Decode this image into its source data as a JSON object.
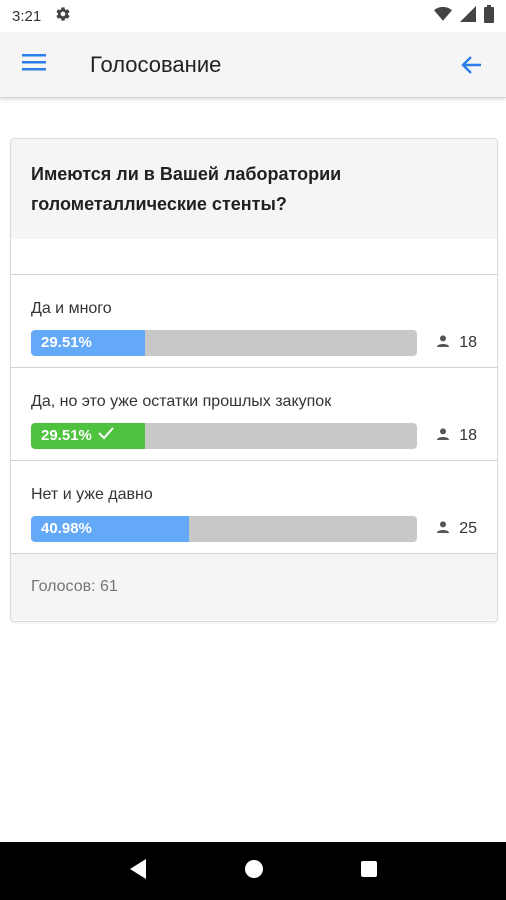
{
  "status_bar": {
    "time": "3:21"
  },
  "header": {
    "title": "Голосование"
  },
  "poll": {
    "question": "Имеются ли в Вашей лаборатории голометаллические стенты?",
    "options": [
      {
        "label": "Да и много",
        "percent_label": "29.51%",
        "fraction": 0.2951,
        "count": "18",
        "selected": false,
        "color": "#64a9f7"
      },
      {
        "label": "Да, но это уже остатки прошлых закупок",
        "percent_label": "29.51%",
        "fraction": 0.2951,
        "count": "18",
        "selected": true,
        "color": "#4fc23f"
      },
      {
        "label": "Нет и уже давно",
        "percent_label": "40.98%",
        "fraction": 0.4098,
        "count": "25",
        "selected": false,
        "color": "#64a9f7"
      }
    ],
    "total_votes": "Голосов: 61"
  },
  "colors": {
    "accent": "#2b7de9",
    "bar_bg": "#c8c8c8"
  }
}
